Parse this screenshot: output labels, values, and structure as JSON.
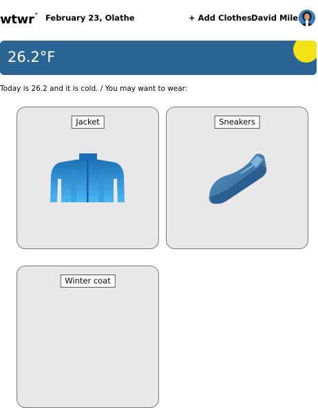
{
  "header": {
    "logo_text": "wtwr",
    "logo_mark": "°",
    "date_location": "February 23, Olathe",
    "add_button_label": "+ Add Clothes",
    "username": "David Miles"
  },
  "weather": {
    "temperature": "26.2°F",
    "icon": "sun-icon",
    "bar_color": "#2b6593",
    "sun_color": "#f5e117"
  },
  "message": "Today is 26.2 and it is cold. / You may want to wear:",
  "items": [
    {
      "name": "Jacket",
      "icon": "jacket-icon"
    },
    {
      "name": "Sneakers",
      "icon": "sneaker-icon"
    },
    {
      "name": "Winter coat",
      "icon": "coat-icon"
    }
  ]
}
